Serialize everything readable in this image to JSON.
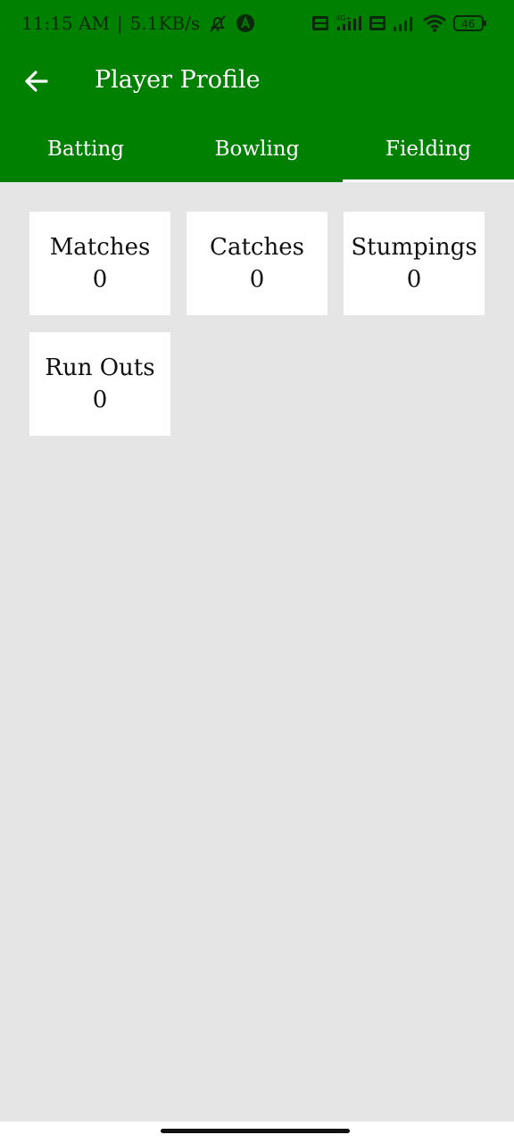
{
  "status_bar": {
    "time": "11:15 AM",
    "net_speed": "5.1KB/s",
    "battery": "46",
    "icons": [
      "muted-bell-icon",
      "app-notification-icon",
      "volte-icon",
      "4g-signal-icon",
      "volte-icon",
      "signal-icon",
      "wifi-icon",
      "battery-icon"
    ]
  },
  "app_bar": {
    "back_icon": "arrow-left-icon",
    "title": "Player Profile"
  },
  "tabs": [
    {
      "label": "Batting",
      "active": false
    },
    {
      "label": "Bowling",
      "active": false
    },
    {
      "label": "Fielding",
      "active": true
    }
  ],
  "stats": [
    {
      "label": "Matches",
      "value": "0"
    },
    {
      "label": "Catches",
      "value": "0"
    },
    {
      "label": "Stumpings",
      "value": "0"
    },
    {
      "label": "Run Outs",
      "value": "0"
    }
  ],
  "colors": {
    "primary": "#008000",
    "background": "#e5e5e5",
    "card": "#ffffff"
  }
}
